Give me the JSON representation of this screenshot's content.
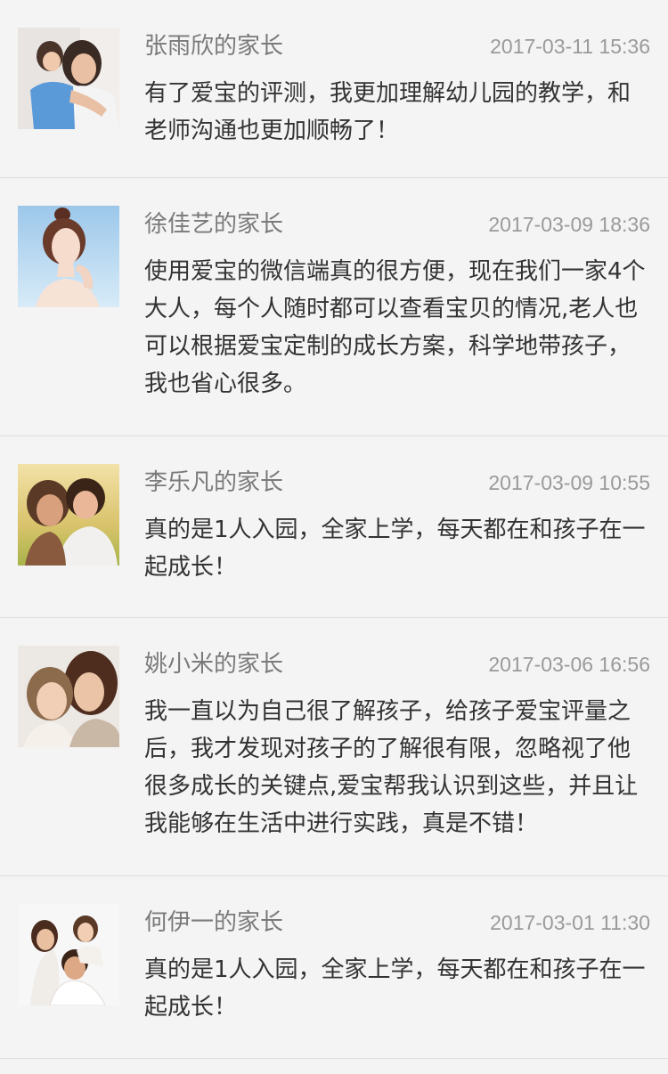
{
  "comments": [
    {
      "name": "张雨欣的家长",
      "time": "2017-03-11 15:36",
      "text": "有了爱宝的评测，我更加理解幼儿园的教学，和老师沟通也更加顺畅了！",
      "avatar_icon": "avatar-mother-hugging-child-photo"
    },
    {
      "name": "徐佳艺的家长",
      "time": "2017-03-09 18:36",
      "text": "使用爱宝的微信端真的很方便，现在我们一家4个大人，每个人随时都可以查看宝贝的情况,老人也可以根据爱宝定制的成长方案，科学地带孩子，我也省心很多。",
      "avatar_icon": "avatar-woman-portrait-photo"
    },
    {
      "name": "李乐凡的家长",
      "time": "2017-03-09 10:55",
      "text": "真的是1人入园，全家上学，每天都在和孩子在一起成长！",
      "avatar_icon": "avatar-mother-daughter-outdoor-photo"
    },
    {
      "name": "姚小米的家长",
      "time": "2017-03-06 16:56",
      "text": "我一直以为自己很了解孩子，给孩子爱宝评量之后，我才发现对孩子的了解很有限，忽略视了他很多成长的关键点,爱宝帮我认识到这些，并且让我能够在生活中进行实践，真是不错！",
      "avatar_icon": "avatar-mother-daughter-smiling-photo"
    },
    {
      "name": "何伊一的家长",
      "time": "2017-03-01 11:30",
      "text": "真的是1人入园，全家上学，每天都在和孩子在一起成长！",
      "avatar_icon": "avatar-family-of-three-photo"
    }
  ]
}
